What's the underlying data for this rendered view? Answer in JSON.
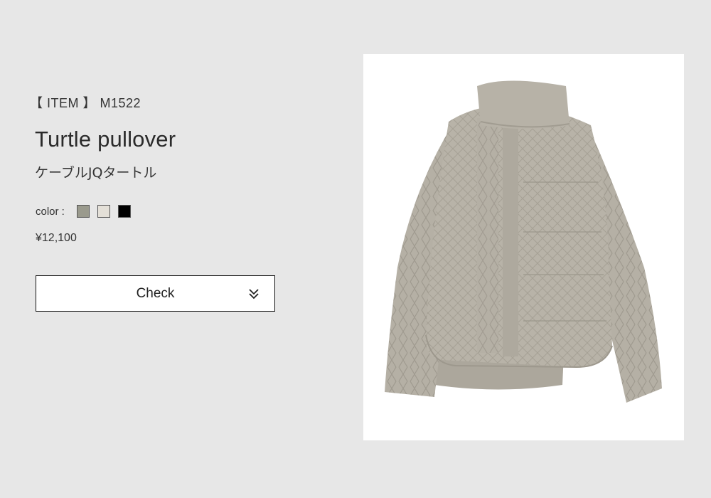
{
  "product": {
    "item_code": "【 ITEM 】 M1522",
    "title": "Turtle pullover",
    "subtitle": "ケーブルJQタートル",
    "color_label": "color :",
    "colors": [
      {
        "name": "greige",
        "hex": "#9a9a8d"
      },
      {
        "name": "off-white",
        "hex": "#e4e0d8"
      },
      {
        "name": "black",
        "hex": "#000000"
      }
    ],
    "price": "¥12,100"
  },
  "actions": {
    "check_label": "Check"
  },
  "icons": {
    "check_button_icon": "double-chevron-down-icon",
    "product_image": "turtle-pullover-photo"
  }
}
